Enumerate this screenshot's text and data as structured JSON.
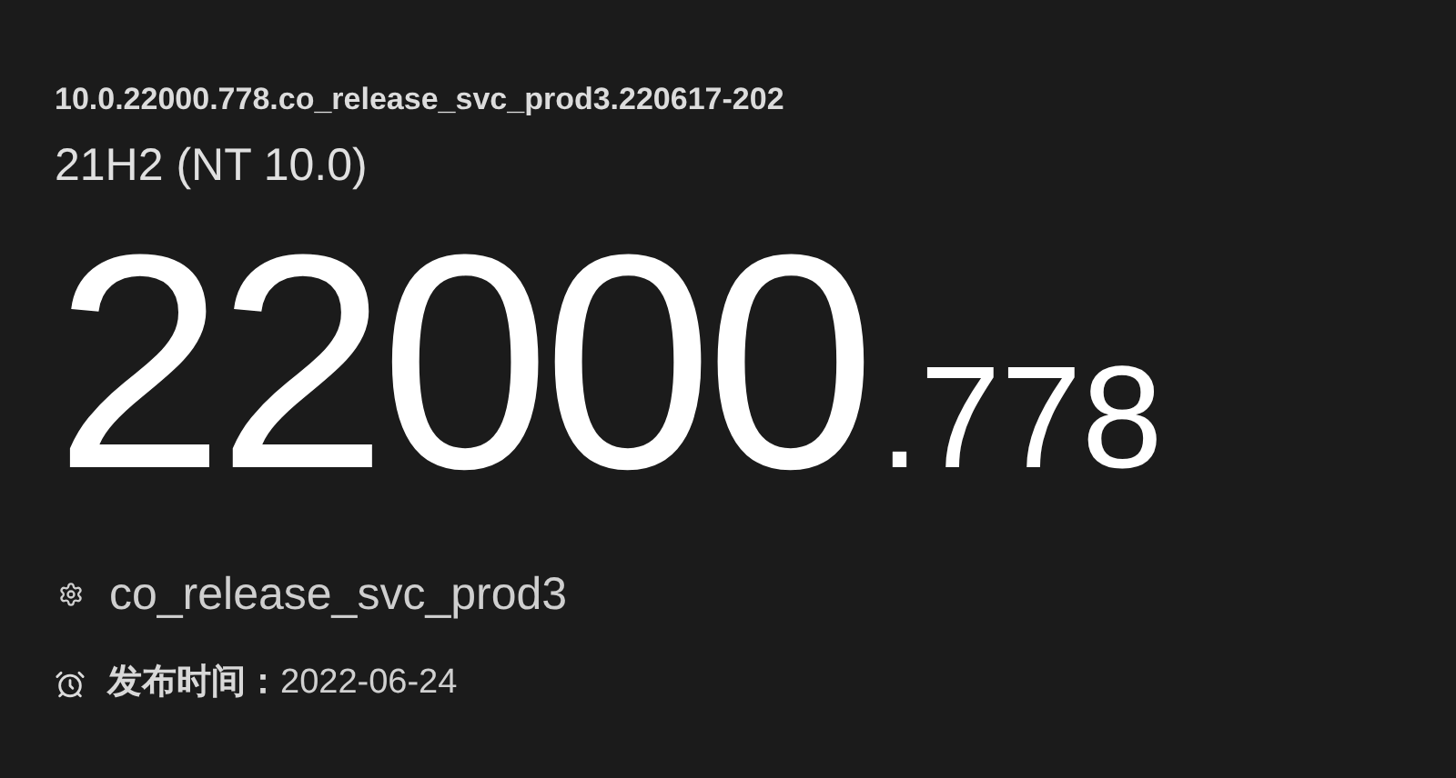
{
  "full_version": "10.0.22000.778.co_release_svc_prod3.220617-202",
  "release_name": "21H2 (NT 10.0)",
  "build": {
    "major": "22000",
    "minor": ".778"
  },
  "branch": "co_release_svc_prod3",
  "release_date": {
    "label": "发布时间：",
    "value": "2022-06-24"
  }
}
